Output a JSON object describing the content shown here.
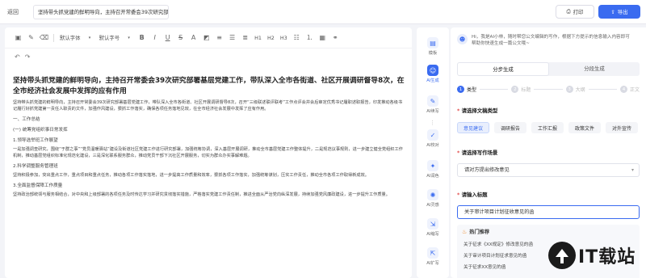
{
  "topbar": {
    "back_label": "返回",
    "doc_title": "坚持带头抓党建的鲜明导向，主持召开常委会39次研究部署...",
    "print_label": "打印",
    "export_label": "导出"
  },
  "toolbar": {
    "font_family": "默认字体",
    "font_size": "默认字号",
    "headings": [
      "H1",
      "H2",
      "H3"
    ]
  },
  "document": {
    "title": "坚持带头抓党建的鲜明导向，主持召开常委会39次研究部署基层党建工作，带队深入全市各街道、社区开展调研督导8次，在全市经济社会发展中发挥的应有作用",
    "intro": "坚持带头抓党建的鲜明导向，主持召开常委会39次研究部署基层党建工作，带队深入全市各街道、社区开展调研督导8次，召开“三级联述联评联考”工作点评会并会后审定优秀书记履职述职报告，印发推动各级书记履行好抓党建第一责任人职责的文件，加强作风建设，狠抓工作落实，确保各项任务落地见效，在全市经济社会发展中发挥了应有作用。",
    "sections": [
      "一、工作总结",
      "(一) 统筹党组织事日常发挥",
      "1.领导选举班工作展望",
      "一是加强调查研究，围绕“于群之事”“党员温暖驿站”建设及街道社区党建工作进行研究部署，加强统筹协调，深入基层开展调研，推动全市基层党建工作整体提升，二是规范议事规则，进一步建立健全党组织工作机制，推动基层党组织标准化规范化建设，三是深化联系服务群众，推动党员干部下沉社区开展服务，切实为群众办实事解难题。",
      "2.科学调整服务管理班",
      "坚持积极参加，突出重点工作，重点项目和重点任务，推动各项工作落实落地，进一步提高工作质量和效率，狠抓各项工作落实，加强统筹谋划，压实工作责任，推动全市各项工作取得新成效。",
      "3.全面监督保障工作质量",
      "坚持政治部统领与服务相结合，对中央和上级部署的各项任务及时传达学习并研究贯彻落实措施，严格落实党建工作责任制，推进全面从严治党向纵深发展，持续加强党风廉政建设，进一步提升工作质量。"
    ]
  },
  "rail": {
    "items": [
      {
        "label": "模板",
        "icon": "template-icon",
        "active": false
      },
      {
        "label": "AI生成",
        "icon": "robot-icon",
        "active": true
      },
      {
        "label": "AI续写",
        "icon": "pen-icon",
        "active": false
      },
      {
        "label": "AI校对",
        "icon": "check-icon",
        "active": false
      },
      {
        "label": "AI润色",
        "icon": "sparkle-icon",
        "active": false
      },
      {
        "label": "AI灵感",
        "icon": "bulb-icon",
        "active": false
      },
      {
        "label": "AI缩写",
        "icon": "compress-icon",
        "active": false
      },
      {
        "label": "AI扩写",
        "icon": "expand-icon",
        "active": false
      }
    ]
  },
  "panel": {
    "greeting": "Hi，我是AI小林，随时帮您公文编辑的写作，根据下方提示的信息输入内容即可帮助你快速生成一篇公文哦~",
    "mode_tabs": [
      "分步生成",
      "分段生成"
    ],
    "steps": [
      {
        "num": "1",
        "label": "类型"
      },
      {
        "num": "2",
        "label": "标题"
      },
      {
        "num": "3",
        "label": "大纲"
      },
      {
        "num": "4",
        "label": "正文"
      }
    ],
    "type_label": "请选择文稿类型",
    "type_options": [
      "意见建议",
      "调研报告",
      "工作汇报",
      "政策文件",
      "对外宣传"
    ],
    "type_active": "意见建议",
    "task_label": "请选择写作场景",
    "task_value": "请对方提出修改意见",
    "title_label": "请输入标题",
    "title_value": "关于审计项目计划征收意见的函",
    "rec_title": "热门推荐",
    "rec_items": [
      "关于征求《XX规定》修改意见的函",
      "关于审计项目计划征求意见的函",
      "关于征求XX意见的函"
    ]
  },
  "watermark": {
    "text": "IT载站"
  }
}
